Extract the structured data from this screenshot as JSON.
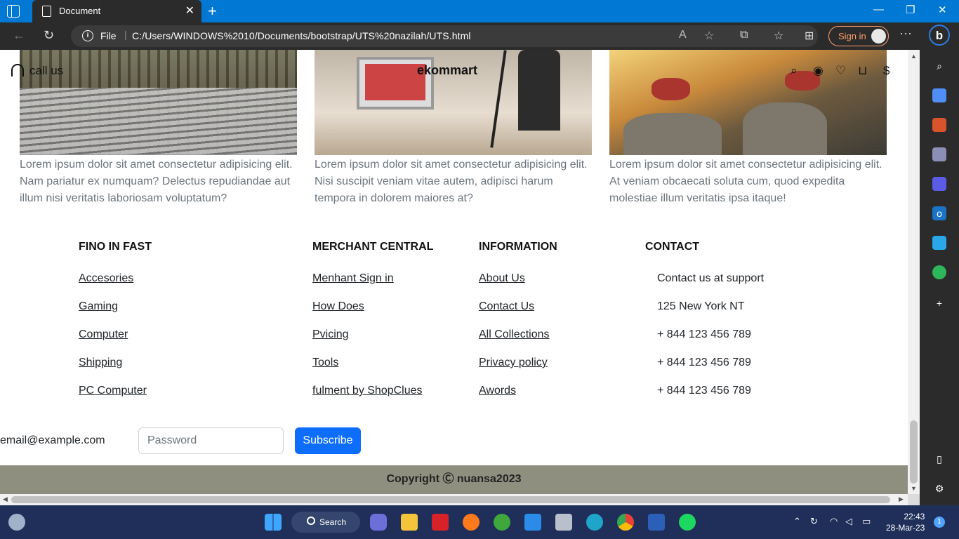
{
  "browser": {
    "tab_title": "Document",
    "file_label": "File",
    "url": "C:/Users/WINDOWS%2010/Documents/bootstrap/UTS%20nazilah/UTS.html",
    "sign_in_label": "Sign in"
  },
  "site_nav": {
    "call_label": "call us",
    "brand": "ekommart",
    "currency": "$"
  },
  "cards": [
    {
      "text": "Lorem ipsum dolor sit amet consectetur adipisicing elit. Nam pariatur ex numquam? Delectus repudiandae aut illum nisi veritatis laboriosam voluptatum?"
    },
    {
      "text": "Lorem ipsum dolor sit amet consectetur adipisicing elit. Nisi suscipit veniam vitae autem, adipisci harum tempora in dolorem maiores at?"
    },
    {
      "text": "Lorem ipsum dolor sit amet consectetur adipisicing elit. At veniam obcaecati soluta cum, quod expedita molestiae illum veritatis ipsa itaque!"
    }
  ],
  "footer": {
    "col1": {
      "heading": "FINO IN FAST",
      "links": [
        "Accesories",
        "Gaming",
        "Computer",
        "Shipping",
        "PC Computer"
      ]
    },
    "col2": {
      "heading": "MERCHANT CENTRAL",
      "links": [
        "Menhant Sign in",
        "How Does",
        "Pvicing",
        "Tools",
        "fulment by ShopClues"
      ]
    },
    "col3": {
      "heading": "INFORMATION",
      "links": [
        "About Us",
        "Contact Us",
        "All Collections",
        "Privacy policy",
        "Awords"
      ]
    },
    "col4": {
      "heading": "CONTACT",
      "lines": [
        "Contact us at support",
        "125 New York NT",
        "+ 844 123 456 789",
        "+ 844 123 456 789",
        "+ 844 123 456 789"
      ]
    }
  },
  "newsletter": {
    "email_label": "email@example.com",
    "password_placeholder": "Password",
    "subscribe_label": "Subscribe"
  },
  "copyright": "Copyright Ⓒ nuansa2023",
  "taskbar": {
    "search_label": "Search",
    "time": "22:43",
    "date": "28-Mar-23",
    "notification_count": "1"
  }
}
